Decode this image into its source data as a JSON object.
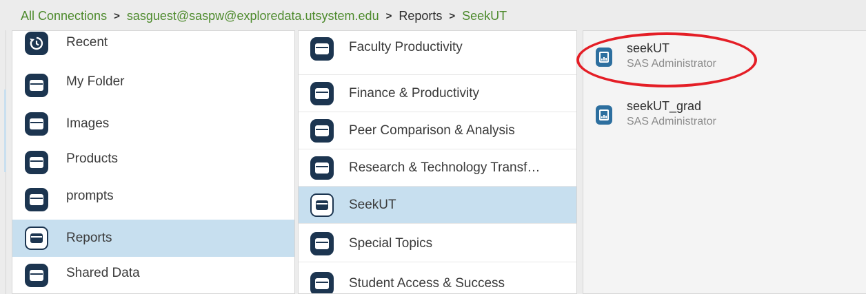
{
  "breadcrumb": {
    "items": [
      "All Connections",
      "sasguest@saspw@exploredata.utsystem.edu",
      "Reports",
      "SeekUT"
    ],
    "separator": ">"
  },
  "folders": [
    {
      "label": "Recent",
      "icon": "recent-history-icon"
    },
    {
      "label": "My Folder",
      "icon": "folder-icon"
    },
    {
      "label": "Images",
      "icon": "folder-icon"
    },
    {
      "label": "Products",
      "icon": "folder-icon"
    },
    {
      "label": "prompts",
      "icon": "folder-icon"
    },
    {
      "label": "Reports",
      "icon": "folder-open-icon",
      "selected": true
    },
    {
      "label": "Shared Data",
      "icon": "folder-icon"
    }
  ],
  "subfolders": [
    {
      "label": "Faculty Productivity"
    },
    {
      "label": "Finance & Productivity"
    },
    {
      "label": "Peer Comparison & Analysis"
    },
    {
      "label": "Research & Technology Transf…"
    },
    {
      "label": "SeekUT",
      "selected": true
    },
    {
      "label": "Special Topics"
    },
    {
      "label": "Student Access & Success"
    }
  ],
  "reports": [
    {
      "name": "seekUT",
      "owner": "SAS Administrator",
      "icon": "report-icon",
      "highlighted": true
    },
    {
      "name": "seekUT_grad",
      "owner": "SAS Administrator",
      "icon": "report-icon"
    }
  ],
  "colors": {
    "breadcrumb_link": "#4d8a2c",
    "selection": "#c7dfef",
    "icon_dark": "#1c3550",
    "report_icon": "#2d6f9f",
    "highlight": "#e41e26"
  }
}
